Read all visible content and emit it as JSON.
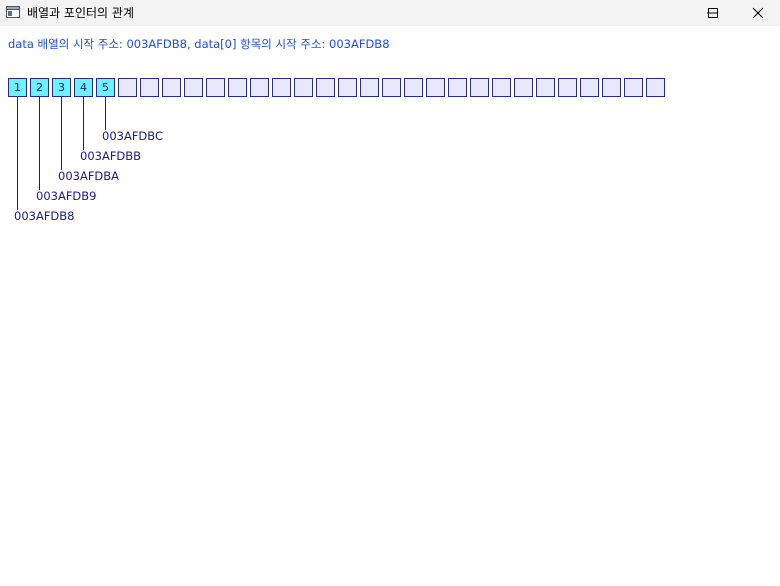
{
  "window": {
    "title": "배열과 포인터의 관계",
    "icon": "app-window-icon"
  },
  "info_text": "data 배열의 시작 주소: 003AFDB8, data[0] 항목의 시작 주소: 003AFDB8",
  "colors": {
    "filled_cell": "#6ff2ff",
    "empty_cell": "#e8e8fb",
    "cell_border": "#2b2b8c",
    "info_text": "#1f4fd6",
    "label_text": "#1a1a8a"
  },
  "array": {
    "total_cells": 30,
    "values": [
      "1",
      "2",
      "3",
      "4",
      "5"
    ]
  },
  "addresses": [
    "003AFDB8",
    "003AFDB9",
    "003AFDBA",
    "003AFDBB",
    "003AFDBC"
  ]
}
